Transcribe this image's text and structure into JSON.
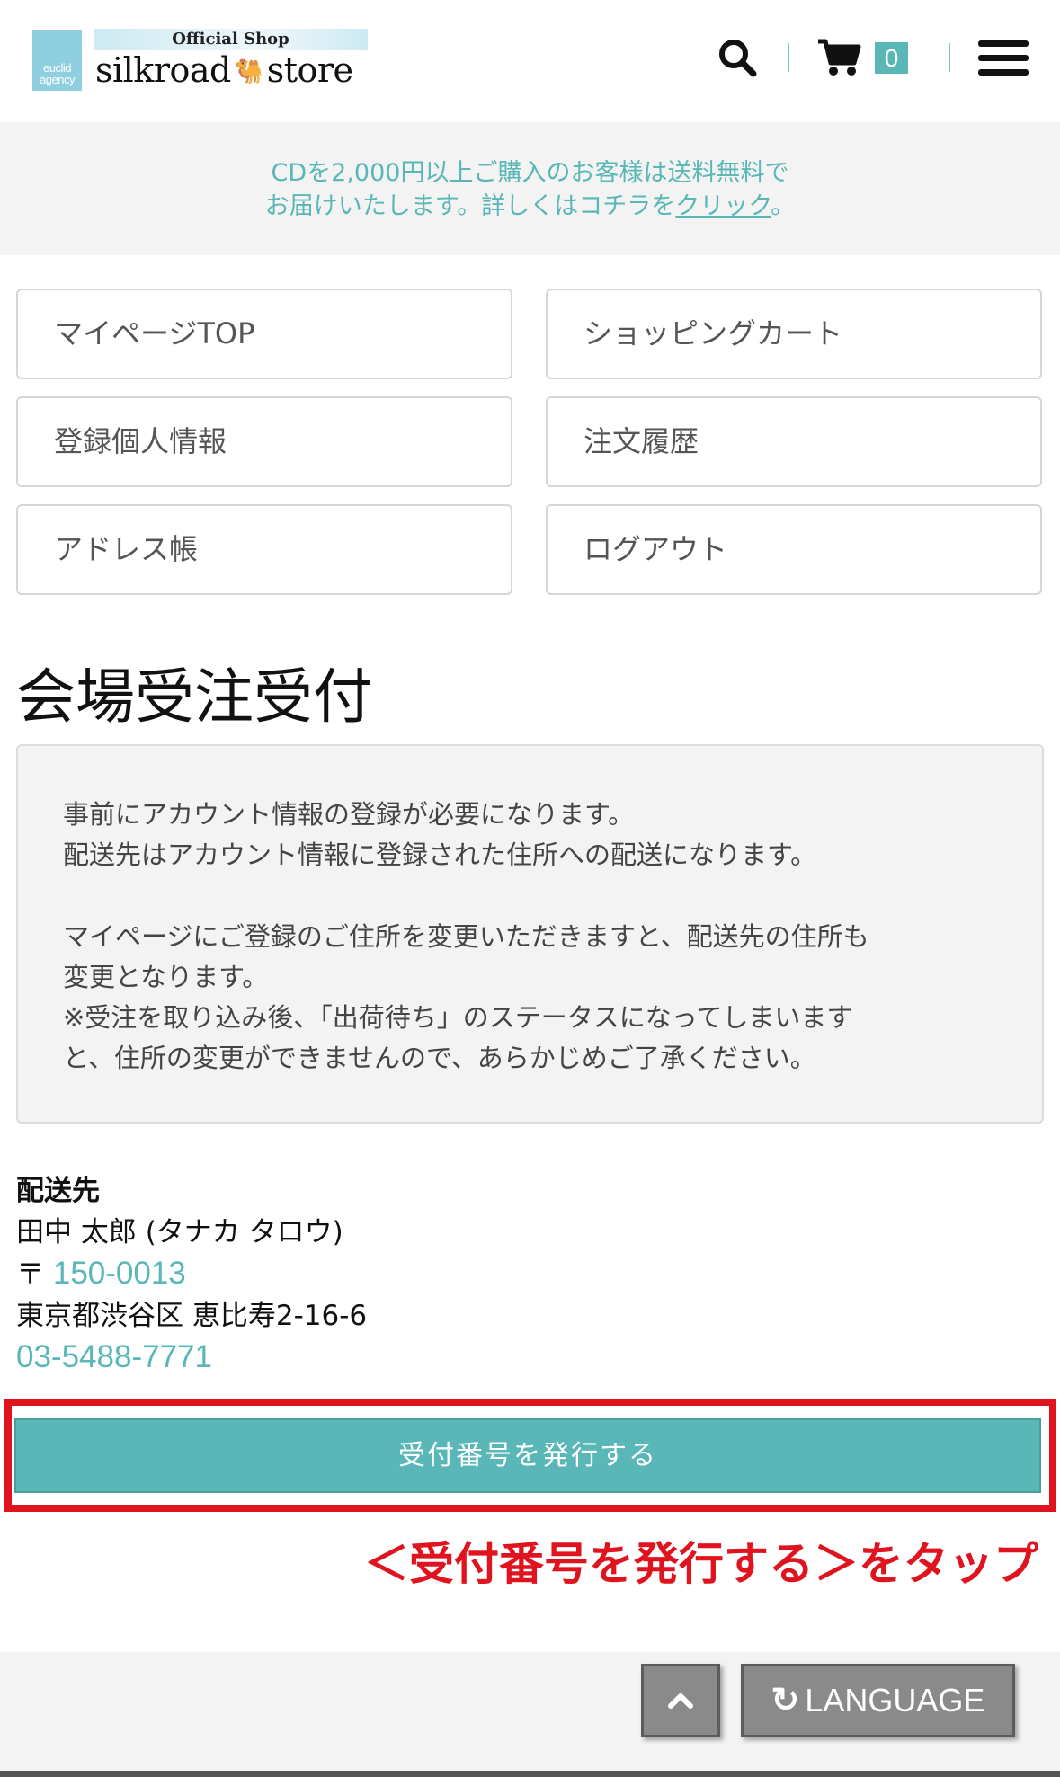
{
  "header": {
    "logo_small_top": "euclid",
    "logo_small_bottom": "agency",
    "logo_banner": "Official Shop",
    "logo_name_left": "silkroad",
    "logo_name_right": "store",
    "cart_count": "0",
    "icons": [
      "search-icon",
      "cart-icon",
      "menu-icon",
      "camel-icon"
    ]
  },
  "notice": {
    "line1": "CDを2,000円以上ご購入のお客様は送料無料で",
    "line2_prefix": "お届けいたします。詳しくはコチラを",
    "line2_link": "クリック",
    "line2_suffix": "。"
  },
  "nav": {
    "mypage_top": "マイページTOP",
    "shopping_cart": "ショッピングカート",
    "profile": "登録個人情報",
    "order_history": "注文履歴",
    "address_book": "アドレス帳",
    "logout": "ログアウト"
  },
  "main": {
    "title": "会場受注受付",
    "info": {
      "line1": "事前にアカウント情報の登録が必要になります。",
      "line2": "配送先はアカウント情報に登録された住所への配送になります。",
      "line3": "マイページにご登録のご住所を変更いただきますと、配送先の住所も",
      "line4": "変更となります。",
      "line5": "※受注を取り込み後、「出荷待ち」のステータスになってしまいます",
      "line6": "と、住所の変更ができませんので、あらかじめご了承ください。"
    },
    "shipping": {
      "label": "配送先",
      "name": "田中 太郎 (タナカ タロウ)",
      "postal_mark": "〒",
      "postal_code": "150-0013",
      "address": "東京都渋谷区 恵比寿2-16-6",
      "phone": "03-5488-7771"
    },
    "issue_button": "受付番号を発行する",
    "tap_instruction": "＜受付番号を発行する＞をタップ"
  },
  "footer": {
    "language_label": "LANGUAGE",
    "icons": [
      "chevron-up-icon",
      "reload-icon"
    ]
  },
  "colors": {
    "accent": "#5ab7b7",
    "highlight": "#e0141e",
    "panel_bg": "#f3f3f3",
    "footer_button": "#8a8a8a"
  }
}
